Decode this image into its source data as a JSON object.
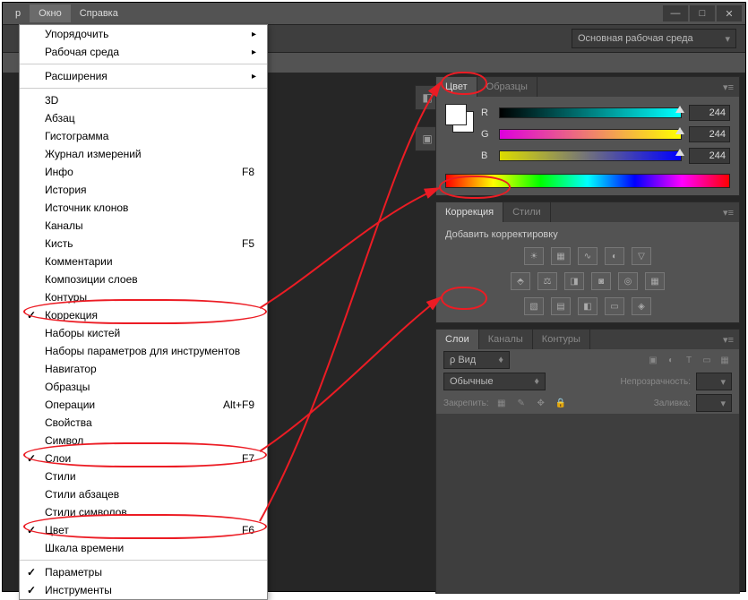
{
  "menubar": {
    "truncated": "р",
    "window": "Окно",
    "help": "Справка"
  },
  "winbuttons": {
    "min": "—",
    "max": "□",
    "close": "✕"
  },
  "toolbar": {
    "workspace": "Основная рабочая среда"
  },
  "menu": {
    "arrange": "Упорядочить",
    "workspace": "Рабочая среда",
    "extensions": "Расширения",
    "d3": "3D",
    "paragraph": "Абзац",
    "histogram": "Гистограмма",
    "measure_log": "Журнал измерений",
    "info": "Инфо",
    "info_sc": "F8",
    "history": "История",
    "clone_src": "Источник клонов",
    "channels": "Каналы",
    "brush": "Кисть",
    "brush_sc": "F5",
    "comments": "Комментарии",
    "layer_comps": "Композиции слоев",
    "paths": "Контуры",
    "adjustments": "Коррекция",
    "brush_presets": "Наборы кистей",
    "tool_presets": "Наборы параметров для инструментов",
    "navigator": "Навигатор",
    "swatches": "Образцы",
    "actions": "Операции",
    "actions_sc": "Alt+F9",
    "properties": "Свойства",
    "symbol": "Символ",
    "layers": "Слои",
    "layers_sc": "F7",
    "styles": "Стили",
    "para_styles": "Стили абзацев",
    "char_styles": "Стили символов",
    "color": "Цвет",
    "color_sc": "F6",
    "timeline": "Шкала времени",
    "options": "Параметры",
    "tools": "Инструменты"
  },
  "color_panel": {
    "tab_color": "Цвет",
    "tab_swatches": "Образцы",
    "r": "R",
    "g": "G",
    "b": "B",
    "r_val": "244",
    "g_val": "244",
    "b_val": "244"
  },
  "corr_panel": {
    "tab_corr": "Коррекция",
    "tab_styles": "Стили",
    "add": "Добавить корректировку"
  },
  "layers_panel": {
    "tab_layers": "Слои",
    "tab_channels": "Каналы",
    "tab_paths": "Контуры",
    "kind": "ρ Вид",
    "mode": "Обычные",
    "opacity": "Непрозрачность:",
    "lock": "Закрепить:",
    "fill": "Заливка:"
  }
}
